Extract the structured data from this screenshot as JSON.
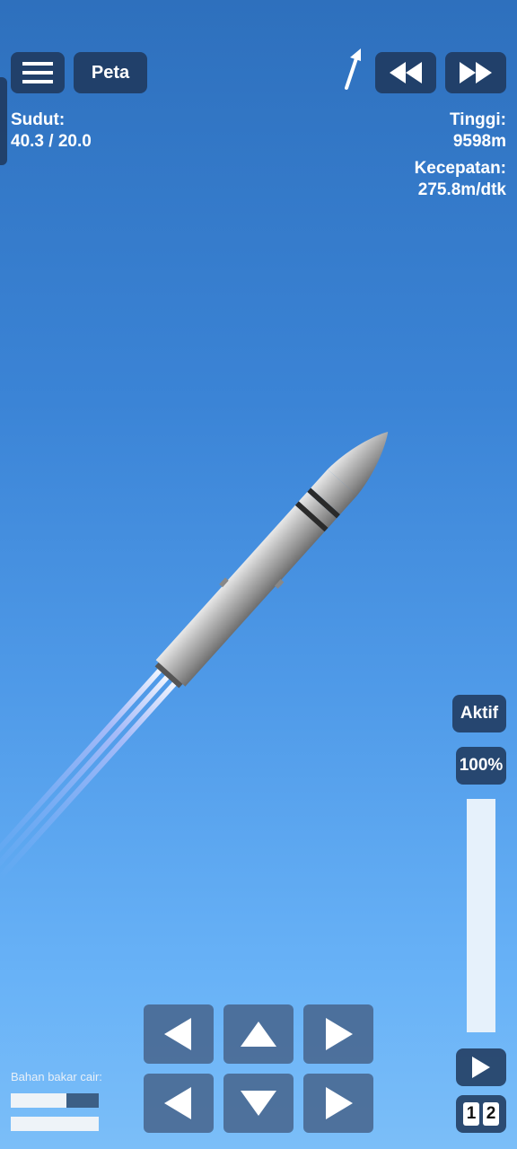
{
  "top_bar": {
    "menu_icon": "hamburger-icon",
    "map_label": "Peta",
    "arrow_icon": "direction-arrow-icon",
    "rewind_icon": "rewind-icon",
    "fast_forward_icon": "fast-forward-icon"
  },
  "hud": {
    "angle_label": "Sudut:",
    "angle_value": "40.3 / 20.0",
    "altitude_label": "Tinggi:",
    "altitude_value": "9598m",
    "speed_label": "Kecepatan:",
    "speed_value": "275.8m/dtk"
  },
  "right_panel": {
    "active_label": "Aktif",
    "throttle_label": "100%",
    "throttle_fraction": 1.0,
    "play_icon": "play-icon",
    "digit_1": "1",
    "digit_2": "2"
  },
  "fuel": {
    "label": "Bahan bakar cair:",
    "bar1_fraction": 0.63,
    "bar2_fraction": 1.0
  },
  "controls": {
    "row1": [
      "left-arrow-icon",
      "up-arrow-icon",
      "right-arrow-icon"
    ],
    "row2": [
      "left-arrow-icon",
      "down-arrow-icon",
      "right-arrow-icon"
    ]
  },
  "colors": {
    "button_bg": "#1e375a",
    "sky_top": "#2e70bd",
    "sky_bottom": "#7bbef8"
  }
}
